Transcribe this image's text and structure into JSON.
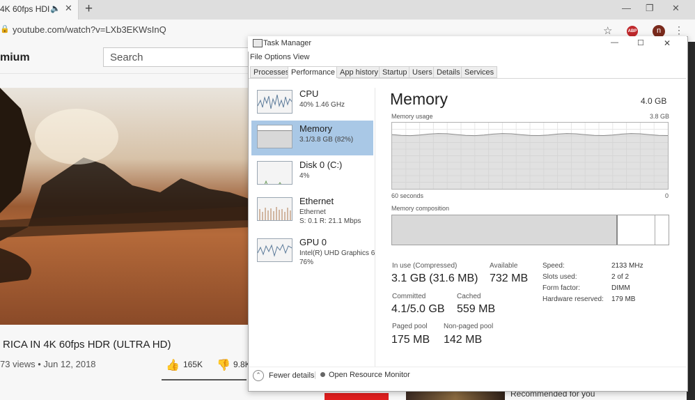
{
  "browser": {
    "tab_title": "4K 60fps HDI",
    "tab_audio_icon": "speaker-icon",
    "tab_close": "✕",
    "new_tab": "+",
    "url": "youtube.com/watch?v=LXb3EKWsInQ",
    "abp_label": "ABP",
    "avatar_letter": "n",
    "window_min": "—",
    "window_restore": "❐",
    "window_close": "✕"
  },
  "youtube": {
    "brand": "mium",
    "search_placeholder": "Search",
    "video_title": "RICA IN 4K 60fps HDR (ULTRA HD)",
    "video_meta": "73 views • Jun 12, 2018",
    "likes": "165K",
    "dislikes": "9.8K",
    "recommended": "Recommended for you"
  },
  "task_manager": {
    "title": "Task Manager",
    "menu": "File  Options  View",
    "tabs": [
      {
        "label": "Processes"
      },
      {
        "label": "Performance"
      },
      {
        "label": "App history"
      },
      {
        "label": "Startup"
      },
      {
        "label": "Users"
      },
      {
        "label": "Details"
      },
      {
        "label": "Services"
      }
    ],
    "resources": [
      {
        "name": "CPU",
        "sub": "40%  1.46 GHz",
        "sub2": ""
      },
      {
        "name": "Memory",
        "sub": "3.1/3.8 GB (82%)",
        "sub2": ""
      },
      {
        "name": "Disk 0 (C:)",
        "sub": "4%",
        "sub2": ""
      },
      {
        "name": "Ethernet",
        "sub": "Ethernet",
        "sub2": "S: 0.1  R: 21.1 Mbps"
      },
      {
        "name": "GPU 0",
        "sub": "Intel(R) UHD Graphics 6",
        "sub2": "76%"
      }
    ],
    "memory": {
      "title": "Memory",
      "total": "4.0 GB",
      "usage_label": "Memory usage",
      "usage_max": "3.8 GB",
      "axis_left": "60 seconds",
      "axis_right": "0",
      "composition_label": "Memory composition",
      "in_use_fraction": 0.815,
      "usage_fraction": 0.82,
      "stats": {
        "in_use_label": "In use (Compressed)",
        "in_use_value": "3.1 GB (31.6 MB)",
        "available_label": "Available",
        "available_value": "732 MB",
        "committed_label": "Committed",
        "committed_value": "4.1/5.0 GB",
        "cached_label": "Cached",
        "cached_value": "559 MB",
        "paged_label": "Paged pool",
        "paged_value": "175 MB",
        "nonpaged_label": "Non-paged pool",
        "nonpaged_value": "142 MB"
      },
      "details": {
        "speed_label": "Speed:",
        "speed_value": "2133 MHz",
        "slots_label": "Slots used:",
        "slots_value": "2 of 2",
        "form_label": "Form factor:",
        "form_value": "DIMM",
        "reserved_label": "Hardware reserved:",
        "reserved_value": "179 MB"
      }
    },
    "footer": {
      "fewer_details": "Fewer details",
      "open_resource_monitor": "Open Resource Monitor"
    }
  }
}
